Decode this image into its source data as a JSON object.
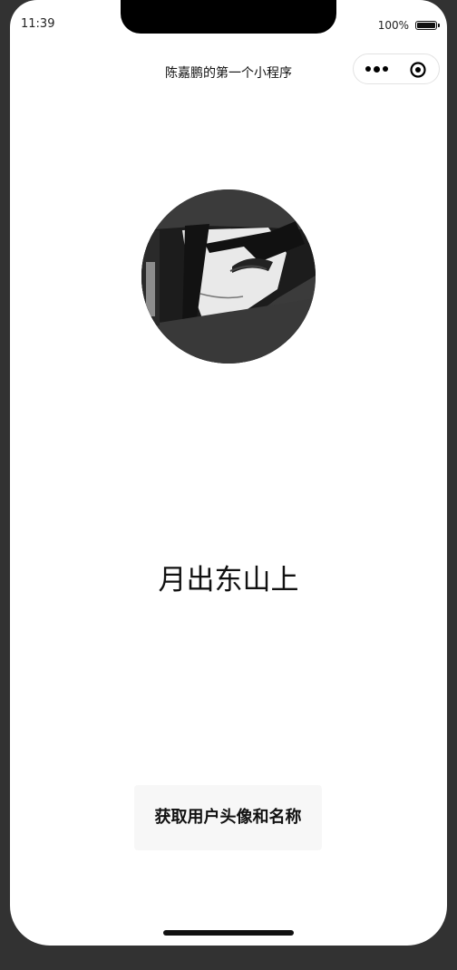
{
  "status_bar": {
    "time": "11:39",
    "battery": "100%"
  },
  "nav": {
    "title": "陈嘉鹏的第一个小程序",
    "more_icon": "more-dots-icon",
    "close_icon": "target-close-icon"
  },
  "profile": {
    "avatar_icon": "user-avatar-image",
    "nickname": "月出东山上"
  },
  "actions": {
    "get_profile_label": "获取用户头像和名称"
  },
  "colors": {
    "background": "#323232",
    "screen": "#ffffff",
    "button_bg": "#f7f7f7",
    "text": "#111111"
  }
}
